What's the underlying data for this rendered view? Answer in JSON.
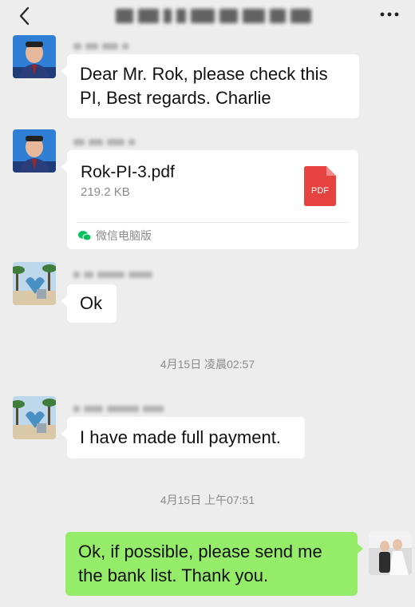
{
  "header": {
    "back_icon": "chevron-left-icon",
    "more_icon": "more-dots-icon"
  },
  "messages": [
    {
      "sender": "contact",
      "text_lines": [
        "Dear Mr. Rok, please check this",
        "PI, Best regards. Charlie"
      ]
    },
    {
      "sender": "contact",
      "file": {
        "name": "Rok-PI-3.pdf",
        "size": "219.2 KB",
        "badge": "PDF",
        "source": "微信电脑版"
      }
    },
    {
      "sender": "other",
      "text": "Ok"
    },
    {
      "sender": "other",
      "text": "I have made full payment."
    },
    {
      "sender": "me",
      "text_lines": [
        "Ok, if possible, please send me",
        "the bank list. Thank you."
      ]
    }
  ],
  "timestamps": [
    "4月15日 凌晨02:57",
    "4月15日 上午07:51"
  ],
  "colors": {
    "background": "#ededed",
    "incoming_bubble": "#ffffff",
    "outgoing_bubble": "#95ec69",
    "pdf_red": "#e64340",
    "wechat_green": "#07c160"
  }
}
